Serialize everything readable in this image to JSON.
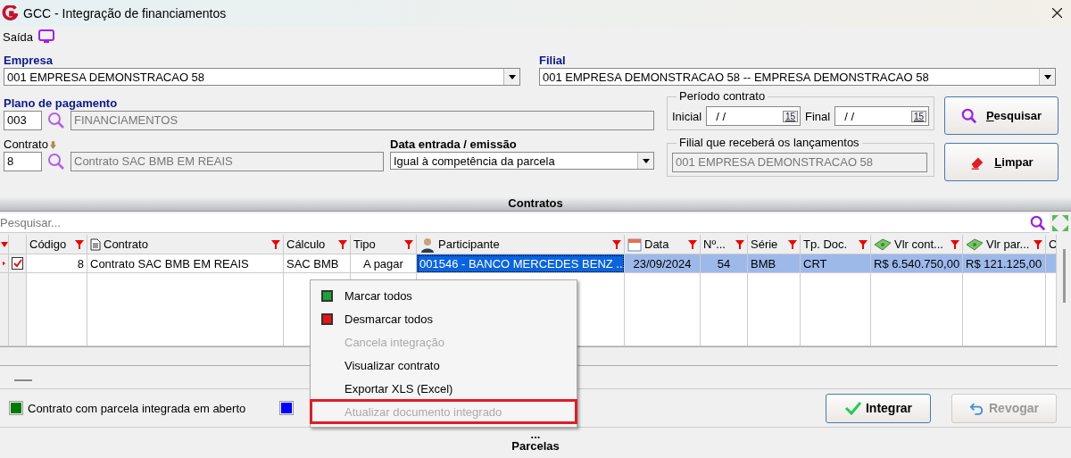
{
  "window": {
    "title": "GCC - Integração de financiamentos"
  },
  "menu": {
    "label": "Saída"
  },
  "empresa": {
    "label": "Empresa",
    "value": "001 EMPRESA DEMONSTRACAO 58"
  },
  "filial": {
    "label": "Filial",
    "value": "001 EMPRESA DEMONSTRACAO 58 -- EMPRESA DEMONSTRACAO 58"
  },
  "plano": {
    "label": "Plano de pagamento",
    "code": "003",
    "description": "FINANCIAMENTOS"
  },
  "periodo": {
    "label": "Período contrato",
    "start_label": "Inicial",
    "start": "/ /",
    "end_label": "Final",
    "end": "/ /",
    "start_calendar": "15",
    "end_calendar": "15"
  },
  "contrato": {
    "label": "Contrato",
    "code": "8",
    "description": "Contrato SAC BMB EM REAIS"
  },
  "data_entrada": {
    "label": "Data entrada / emissão",
    "value": "Igual à competência da parcela"
  },
  "filial_lanc": {
    "label": "Filial que receberá os lançamentos",
    "value": "001 EMPRESA DEMONSTRACAO 58",
    "disabled": true
  },
  "buttons": [
    {
      "label": "Pesquisar",
      "kind": "search",
      "disabled": false
    },
    {
      "label": "Limpar",
      "kind": "eraser",
      "disabled": false
    }
  ],
  "section": {
    "title": "Contratos"
  },
  "search": {
    "placeholder": "Pesquisar..."
  },
  "table": {
    "columns": [
      {
        "label": "Código",
        "kind": "text"
      },
      {
        "label": "Contrato",
        "kind": "document"
      },
      {
        "label": "Cálculo",
        "kind": "text"
      },
      {
        "label": "Tipo",
        "kind": "text"
      },
      {
        "label": "Participante",
        "kind": "person"
      },
      {
        "label": "Data",
        "kind": "date"
      },
      {
        "label": "Nº...",
        "kind": "text"
      },
      {
        "label": "Série",
        "kind": "text"
      },
      {
        "label": "Tp. Doc.",
        "kind": "text"
      },
      {
        "label": "Vlr cont...",
        "kind": "money"
      },
      {
        "label": "Vlr par...",
        "kind": "money"
      },
      {
        "label": "C",
        "kind": "text"
      }
    ],
    "rows": [
      {
        "current": true,
        "checked": true,
        "selected": true,
        "cells": [
          "8",
          "Contrato SAC BMB EM REAIS",
          "SAC BMB",
          "A pagar",
          "001546 - BANCO MERCEDES BENZ ...",
          "23/09/2024",
          "54",
          "BMB",
          "CRT",
          "R$ 6.540.750,00",
          "R$ 121.125,00",
          ""
        ]
      }
    ]
  },
  "context_menu": {
    "items": [
      {
        "label": "Marcar todos",
        "disabled": false,
        "highlighted": false,
        "color": "#1aa33a"
      },
      {
        "label": "Desmarcar todos",
        "disabled": false,
        "highlighted": false,
        "color": "#ee1111"
      },
      {
        "label": "Cancela integração",
        "disabled": true,
        "highlighted": false
      },
      {
        "label": "Visualizar contrato",
        "disabled": false,
        "highlighted": false
      },
      {
        "label": "Exportar XLS (Excel)",
        "disabled": false,
        "highlighted": false
      },
      {
        "label": "Atualizar documento integrado",
        "disabled": true,
        "highlighted": true
      }
    ]
  },
  "legend": [
    {
      "color": "#007a00",
      "label": "Contrato com parcela integrada em aberto"
    },
    {
      "color": "#0000ff"
    }
  ],
  "actions": [
    {
      "label": "Integrar",
      "kind": "check",
      "disabled": false
    },
    {
      "label": "Revogar",
      "kind": "undo",
      "disabled": true
    }
  ],
  "footer": {
    "handle": "...",
    "next_section": "Parcelas"
  }
}
